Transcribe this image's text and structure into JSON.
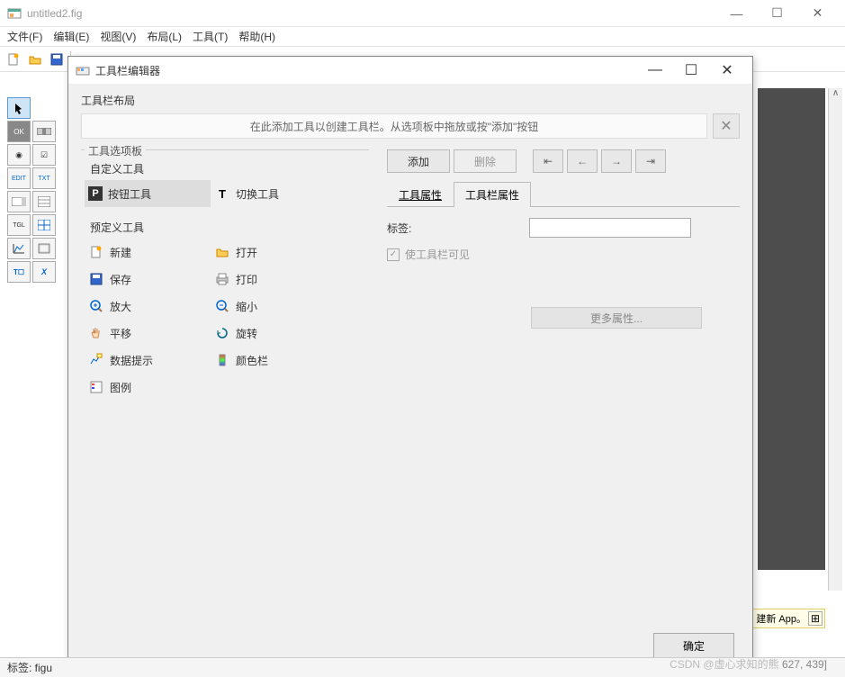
{
  "window": {
    "title": "untitled2.fig",
    "menus": [
      "文件(F)",
      "编辑(E)",
      "视图(V)",
      "布局(L)",
      "工具(T)",
      "帮助(H)"
    ]
  },
  "dialog": {
    "title": "工具栏编辑器",
    "layout_label": "工具栏布局",
    "layout_hint": "在此添加工具以创建工具栏。从选项板中拖放或按\"添加\"按钮",
    "palette_label": "工具选项板",
    "custom_label": "自定义工具",
    "custom_tools": [
      {
        "label": "按钮工具",
        "icon": "P"
      },
      {
        "label": "切换工具",
        "icon": "T"
      }
    ],
    "predef_label": "预定义工具",
    "predef_tools": [
      {
        "label": "新建",
        "icon": "new"
      },
      {
        "label": "打开",
        "icon": "open"
      },
      {
        "label": "保存",
        "icon": "save"
      },
      {
        "label": "打印",
        "icon": "print"
      },
      {
        "label": "放大",
        "icon": "zoom-in"
      },
      {
        "label": "缩小",
        "icon": "zoom-out"
      },
      {
        "label": "平移",
        "icon": "pan"
      },
      {
        "label": "旋转",
        "icon": "rotate"
      },
      {
        "label": "数据提示",
        "icon": "datatip"
      },
      {
        "label": "颜色栏",
        "icon": "colorbar"
      },
      {
        "label": "图例",
        "icon": "legend"
      }
    ],
    "actions": {
      "add": "添加",
      "delete": "删除"
    },
    "tabs": {
      "tool_props": "工具属性",
      "toolbar_props": "工具栏属性"
    },
    "props": {
      "label": "标签:",
      "visible": "使工具栏可见",
      "more": "更多属性..."
    },
    "ok": "确定"
  },
  "hint": {
    "text": "建新 App。"
  },
  "status": {
    "label": "标签: figu"
  },
  "watermark": "CSDN @虚心求知的熊",
  "coord": "627, 439]"
}
